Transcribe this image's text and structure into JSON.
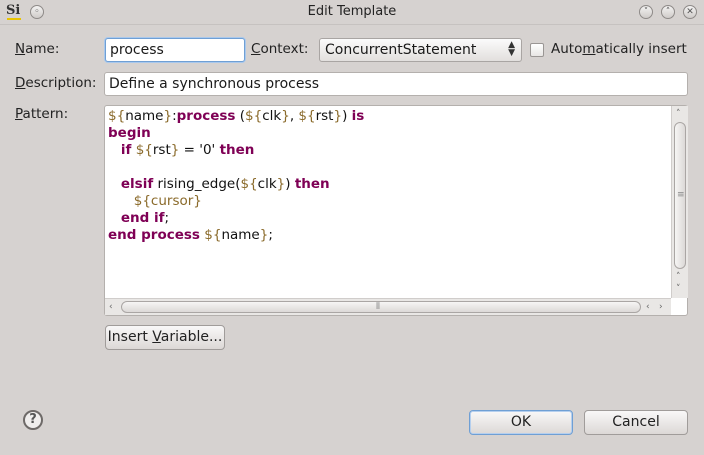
{
  "window": {
    "title": "Edit Template",
    "app_logo": "Si",
    "minimize_symbol": "˅",
    "maximize_symbol": "˄",
    "close_symbol": "✕"
  },
  "form": {
    "name_label_mnemonic": "N",
    "name_label_rest": "ame:",
    "name_value": "process",
    "context_label_mnemonic": "C",
    "context_label_rest": "ontext:",
    "context_value": "ConcurrentStatement",
    "auto_insert_label_pre": "Auto",
    "auto_insert_label_mnemonic": "m",
    "auto_insert_label_post": "atically insert",
    "auto_insert_checked": false,
    "description_label_mnemonic": "D",
    "description_label_rest": "escription:",
    "description_value": "Define a synchronous process",
    "pattern_label_mnemonic": "P",
    "pattern_label_rest": "attern:"
  },
  "pattern_lines": [
    [
      {
        "t": "${",
        "c": "var"
      },
      {
        "t": "name",
        "c": ""
      },
      {
        "t": "}",
        "c": "var"
      },
      {
        "t": ":",
        "c": ""
      },
      {
        "t": "process",
        "c": "kw"
      },
      {
        "t": " (",
        "c": ""
      },
      {
        "t": "${",
        "c": "var"
      },
      {
        "t": "clk",
        "c": ""
      },
      {
        "t": "}",
        "c": "var"
      },
      {
        "t": ", ",
        "c": ""
      },
      {
        "t": "${",
        "c": "var"
      },
      {
        "t": "rst",
        "c": ""
      },
      {
        "t": "}",
        "c": "var"
      },
      {
        "t": ") ",
        "c": ""
      },
      {
        "t": "is",
        "c": "kw"
      }
    ],
    [
      {
        "t": "begin",
        "c": "kw"
      }
    ],
    [
      {
        "t": "   ",
        "c": ""
      },
      {
        "t": "if",
        "c": "kw"
      },
      {
        "t": " ",
        "c": ""
      },
      {
        "t": "${",
        "c": "var"
      },
      {
        "t": "rst",
        "c": ""
      },
      {
        "t": "}",
        "c": "var"
      },
      {
        "t": " = '0' ",
        "c": ""
      },
      {
        "t": "then",
        "c": "kw"
      }
    ],
    [
      {
        "t": "",
        "c": ""
      }
    ],
    [
      {
        "t": "   ",
        "c": ""
      },
      {
        "t": "elsif",
        "c": "kw"
      },
      {
        "t": " rising_edge(",
        "c": ""
      },
      {
        "t": "${",
        "c": "var"
      },
      {
        "t": "clk",
        "c": ""
      },
      {
        "t": "}",
        "c": "var"
      },
      {
        "t": ") ",
        "c": ""
      },
      {
        "t": "then",
        "c": "kw"
      }
    ],
    [
      {
        "t": "      ",
        "c": ""
      },
      {
        "t": "${cursor}",
        "c": "var"
      }
    ],
    [
      {
        "t": "   ",
        "c": ""
      },
      {
        "t": "end if",
        "c": "kw"
      },
      {
        "t": ";",
        "c": ""
      }
    ],
    [
      {
        "t": "end process",
        "c": "kw"
      },
      {
        "t": " ",
        "c": ""
      },
      {
        "t": "${",
        "c": "var"
      },
      {
        "t": "name",
        "c": ""
      },
      {
        "t": "}",
        "c": "var"
      },
      {
        "t": ";",
        "c": ""
      }
    ]
  ],
  "buttons": {
    "insert_variable_pre": "Insert ",
    "insert_variable_mnemonic": "V",
    "insert_variable_post": "ariable...",
    "ok": "OK",
    "cancel": "Cancel",
    "help_symbol": "?"
  },
  "icons": {
    "help": "help-icon",
    "combo_arrows": "up-down-chevron-icon"
  }
}
